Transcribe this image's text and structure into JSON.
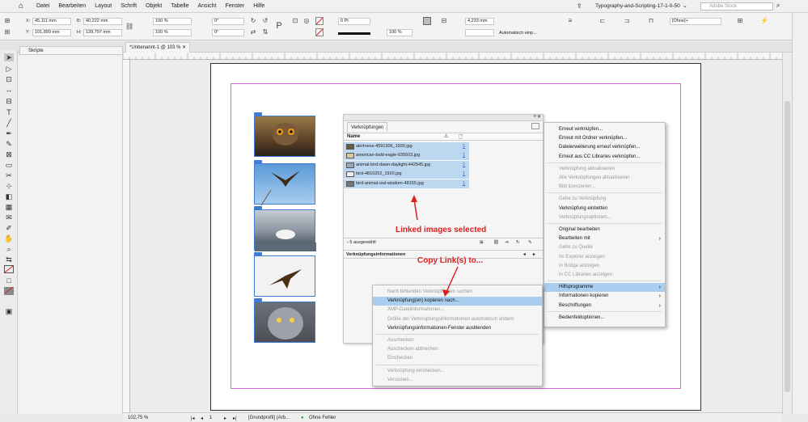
{
  "menubar": {
    "items": [
      "Datei",
      "Bearbeiten",
      "Layout",
      "Schrift",
      "Objekt",
      "Tabelle",
      "Ansicht",
      "Fenster",
      "Hilfe"
    ],
    "doc_title": "Typography-and-Scripting-17-1-0-50",
    "stock_placeholder": "Adobe Stock"
  },
  "control": {
    "x_label": "X:",
    "x": "45,111 mm",
    "y_label": "Y:",
    "y": "101,899 mm",
    "b_label": "B:",
    "b": "40,222 mm",
    "h_label": "H:",
    "h": "139,797 mm",
    "scale1": "100 %",
    "scale2": "100 %",
    "angle1": "0°",
    "angle2": "0°",
    "stroke": "0 Pt",
    "opacity": "100 %",
    "offset": "4,233 mm",
    "auto_fit": "Automatisch einp...",
    "style": "[Ohne]+"
  },
  "tabs": {
    "document": "*Unbenannt-1 @ 103 %",
    "scripts": "Skripte"
  },
  "links_panel": {
    "title": "Verknüpfungen",
    "col_name": "Name",
    "rows": [
      {
        "name": "alertness-4591306_1920.jpg",
        "page": "1"
      },
      {
        "name": "american-bald-eagle-635503.jpg",
        "page": "1"
      },
      {
        "name": "animal-bird-dawn-daylight-442545.jpg",
        "page": "1"
      },
      {
        "name": "bird-4810252_1920.jpg",
        "page": "1"
      },
      {
        "name": "bird-animal-owl-wisdom-48155.jpg",
        "page": "1"
      }
    ],
    "selected": "5 ausgewählt",
    "info": "Verknüpfungsinformationen"
  },
  "flyout": {
    "items": [
      {
        "label": "Erneut verknüpfen...",
        "dis": false
      },
      {
        "label": "Erneut mit Ordner verknüpfen...",
        "dis": false
      },
      {
        "label": "Dateierweiterung erneut verknüpfen...",
        "dis": false
      },
      {
        "label": "Erneut aus CC Libraries verknüpfen...",
        "dis": false
      },
      {
        "label": "Verknüpfung aktualisieren",
        "dis": true
      },
      {
        "label": "Alle Verknüpfungen aktualisieren",
        "dis": true
      },
      {
        "label": "Bild lizenzieren...",
        "dis": true
      },
      {
        "label": "Gehe zu Verknüpfung",
        "dis": true
      },
      {
        "label": "Verknüpfung einbetten",
        "dis": false
      },
      {
        "label": "Verknüpfungsoptionen...",
        "dis": true
      },
      {
        "label": "Original bearbeiten",
        "dis": false
      },
      {
        "label": "Bearbeiten mit",
        "dis": false
      },
      {
        "label": "Gehe zu Quelle",
        "dis": true
      },
      {
        "label": "Im Explorer anzeigen",
        "dis": true
      },
      {
        "label": "In Bridge anzeigen",
        "dis": true
      },
      {
        "label": "In CC Libraries anzeigen",
        "dis": true
      },
      {
        "label": "Hilfsprogramme",
        "dis": false
      },
      {
        "label": "Informationen kopieren",
        "dis": false
      },
      {
        "label": "Beschriftungen",
        "dis": false
      },
      {
        "label": "Bedienfeldoptionen...",
        "dis": false
      }
    ]
  },
  "submenu": {
    "items": [
      {
        "label": "Nach fehlenden Verknüpfungen suchen",
        "dis": true
      },
      {
        "label": "Verknüpfung(en) kopieren nach...",
        "dis": false
      },
      {
        "label": "XMP-Dateiinformationen...",
        "dis": true
      },
      {
        "label": "Größe der Verknüpfungsinformationen automatisch ändern",
        "dis": true
      },
      {
        "label": "Verknüpfungsinformationen-Fenster ausblenden",
        "dis": false
      },
      {
        "label": "Auschecken",
        "dis": true
      },
      {
        "label": "Auschecken abbrechen",
        "dis": true
      },
      {
        "label": "Einchecken",
        "dis": true
      },
      {
        "label": "Verknüpfung einchecken...",
        "dis": true
      },
      {
        "label": "Versionen...",
        "dis": true
      }
    ]
  },
  "annotations": {
    "linked": "Linked images selected",
    "copy": "Copy Link(s) to..."
  },
  "status": {
    "zoom": "102,75 %",
    "page": "1",
    "profile": "[Grundprofil] (Arb...",
    "errors": "Ohne Fehler"
  },
  "colors": {
    "selection": "#bcd8f1",
    "highlight": "#a8cef0",
    "annotation": "#e02020",
    "frame": "#3d7bd6",
    "margin": "#d36ad3"
  }
}
